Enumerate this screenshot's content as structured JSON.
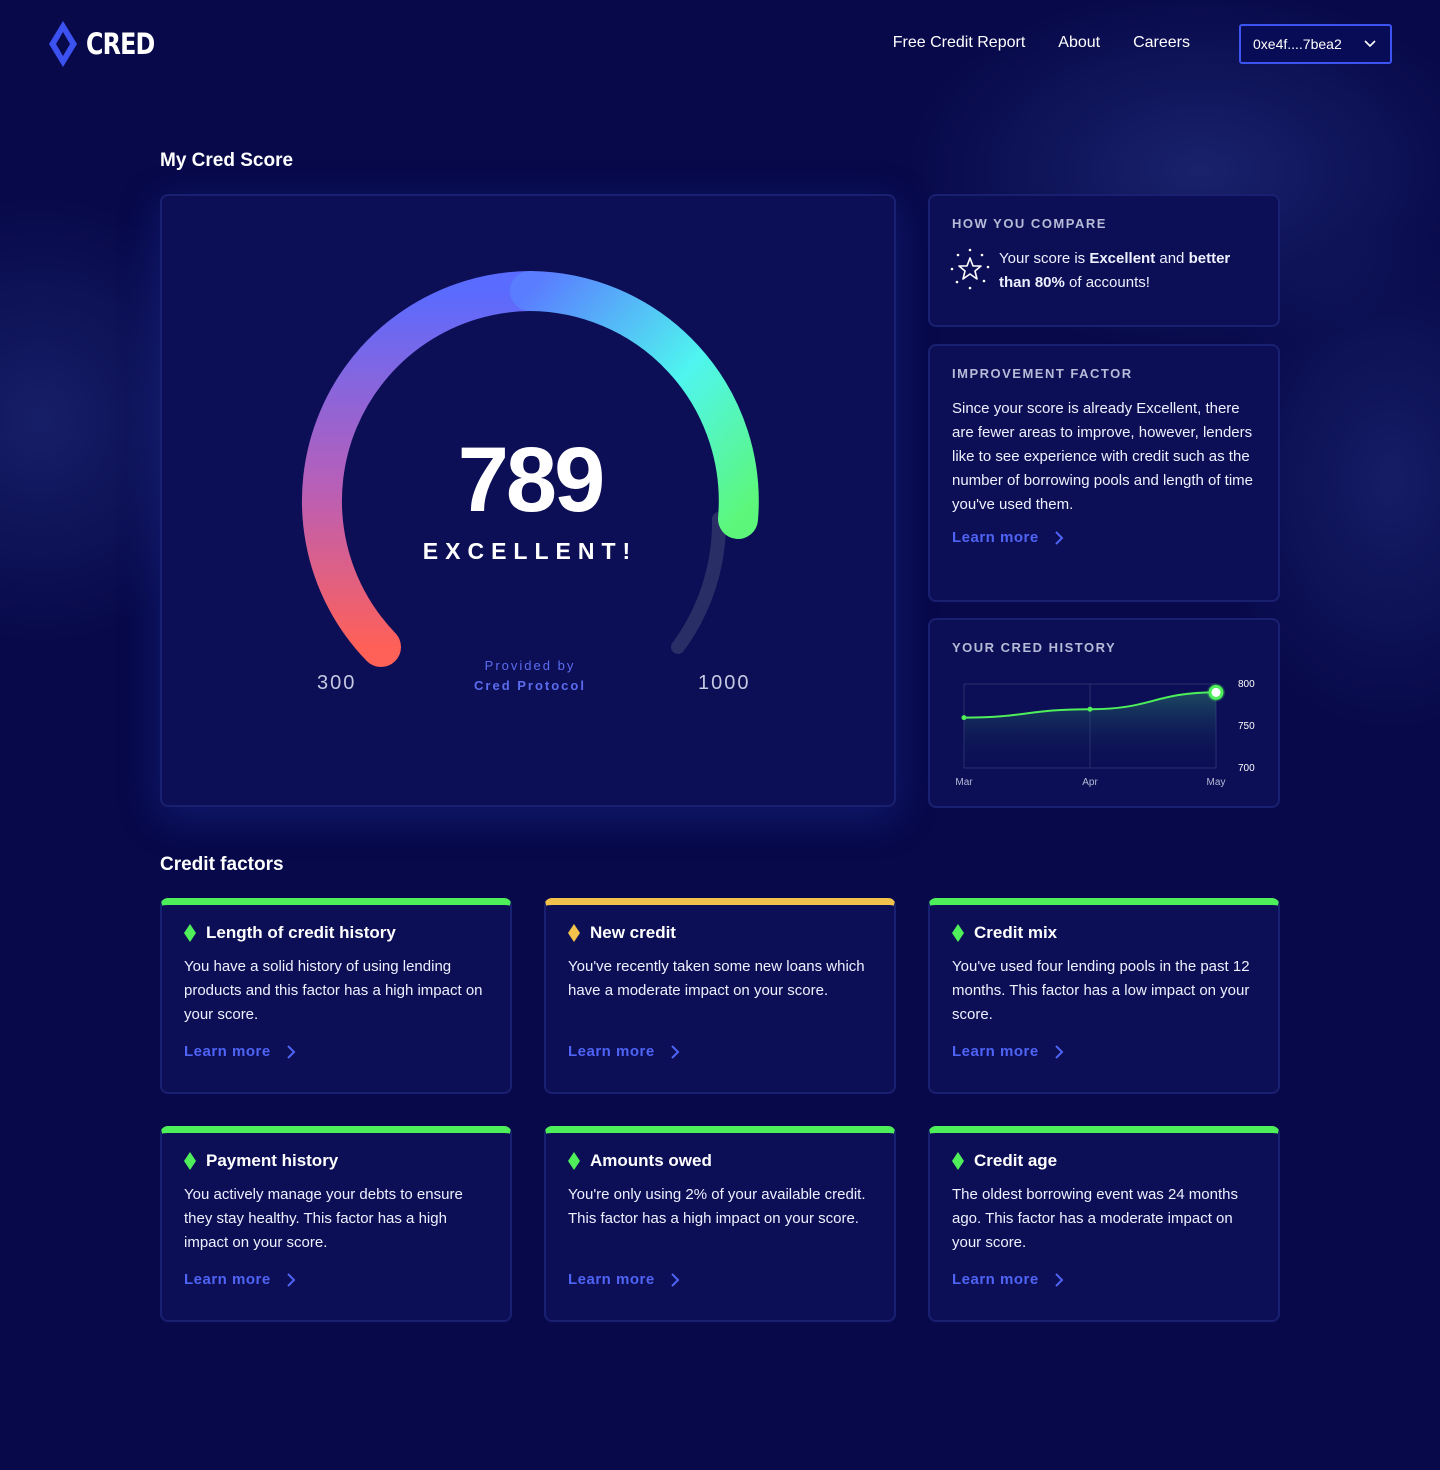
{
  "brand": {
    "name": "CRED"
  },
  "nav": {
    "items": [
      "Free Credit Report",
      "About",
      "Careers"
    ]
  },
  "wallet": {
    "address": "0xe4f....7bea2"
  },
  "score_section": {
    "title": "My Cred Score",
    "score": "789",
    "rating": "EXCELLENT!",
    "range_min": "300",
    "range_max": "1000",
    "provided_by_label": "Provided by",
    "provider": "Cred Protocol",
    "score_value": 789,
    "scale": [
      300,
      1000
    ]
  },
  "compare": {
    "heading": "HOW YOU COMPARE",
    "text_1": "Your score is ",
    "bold_1": "Excellent",
    "text_2": " and ",
    "bold_2": "better than 80%",
    "text_3": " of accounts!"
  },
  "improvement": {
    "heading": "IMPROVEMENT FACTOR",
    "text": "Since your score is already Excellent, there are fewer areas to improve, however, lenders like to see experience with credit such as the number of borrowing pools and length of time you've used them.",
    "link": "Learn more"
  },
  "history": {
    "heading": "YOUR CRED HISTORY"
  },
  "chart_data": {
    "type": "line",
    "x": [
      "Mar",
      "Apr",
      "May"
    ],
    "series": [
      {
        "values": [
          760,
          770,
          790
        ]
      }
    ],
    "y_ticks": [
      "800",
      "750",
      "700"
    ],
    "ylim": [
      700,
      800
    ],
    "grid": true,
    "color": "#4eef5a"
  },
  "factors_section": {
    "title": "Credit factors"
  },
  "factors": [
    {
      "title": "Length of credit history",
      "text": "You have a solid history of using lending products and this factor has a high impact on your score.",
      "link": "Learn more",
      "color": "#4eef5a"
    },
    {
      "title": "New credit",
      "text": "You've recently taken some new loans which have a moderate impact on your score.",
      "link": "Learn more",
      "color": "#f2c24d"
    },
    {
      "title": "Credit mix",
      "text": "You've used four lending pools in the past 12 months.  This factor has a low impact on your score.",
      "link": "Learn more",
      "color": "#4eef5a"
    },
    {
      "title": "Payment history",
      "text": "You actively manage your debts to ensure they stay healthy.  This factor has a high impact on your score.",
      "link": "Learn more",
      "color": "#4eef5a"
    },
    {
      "title": "Amounts owed",
      "text": "You're only using 2% of your available credit.  This factor has a high impact on your score.",
      "link": "Learn more",
      "color": "#4eef5a"
    },
    {
      "title": "Credit age",
      "text": "The oldest borrowing event was 24 months ago.  This factor has a moderate impact on your score.",
      "link": "Learn more",
      "color": "#4eef5a"
    }
  ]
}
